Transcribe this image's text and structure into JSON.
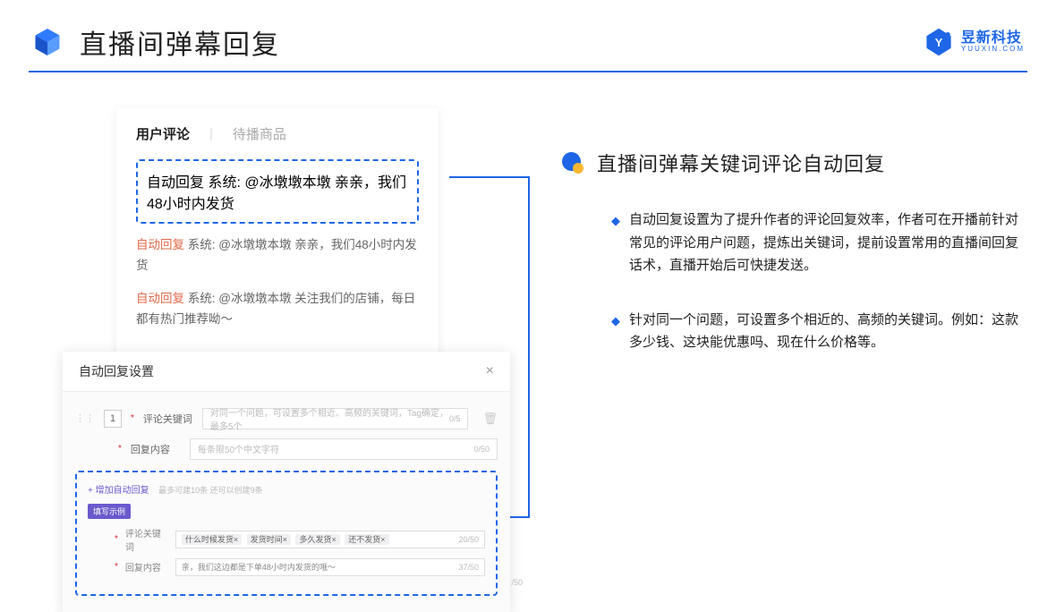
{
  "header": {
    "title": "直播间弹幕回复",
    "brand_cn": "昱新科技",
    "brand_en": "YUUXIN.COM"
  },
  "right": {
    "section_title": "直播间弹幕关键词评论自动回复",
    "bullets": [
      "自动回复设置为了提升作者的评论回复效率，作者可在开播前针对常见的评论用户问题，提炼出关键词，提前设置常用的直播间回复话术，直播开始后可快捷发送。",
      "针对同一个问题，可设置多个相近的、高频的关键词。例如：这款多少钱、这块能优惠吗、现在什么价格等。"
    ]
  },
  "comments": {
    "tab_active": "用户评论",
    "tab_other": "待播商品",
    "items": [
      {
        "prefix": "自动回复",
        "text": "系统: @冰墩墩本墩 亲亲，我们48小时内发货"
      },
      {
        "prefix": "自动回复",
        "text": "系统: @冰墩墩本墩 亲亲，我们48小时内发货"
      },
      {
        "prefix": "自动回复",
        "text": "系统: @冰墩墩本墩 关注我们的店铺，每日都有热门推荐呦～"
      }
    ]
  },
  "modal": {
    "title": "自动回复设置",
    "row_num": "1",
    "label_keyword": "评论关键词",
    "label_reply": "回复内容",
    "keyword_placeholder": "对同一个问题，可设置多个相近、高频的关键词，Tag确定，最多5个",
    "keyword_count": "0/5",
    "reply_placeholder": "每条限50个中文字符",
    "reply_count": "0/50",
    "add_link": "+ 增加自动回复",
    "add_note": "最多可建10条 还可以创建9条",
    "badge": "填写示例",
    "ex_keyword_label": "评论关键词",
    "ex_tags": [
      "什么时候发货×",
      "发货时间×",
      "多久发货×",
      "还不发货×"
    ],
    "ex_kw_count": "20/50",
    "ex_reply_label": "回复内容",
    "ex_reply_value": "亲，我们这边都是下单48小时内发货的哦～",
    "ex_reply_count": "37/50",
    "stray": "/50"
  }
}
